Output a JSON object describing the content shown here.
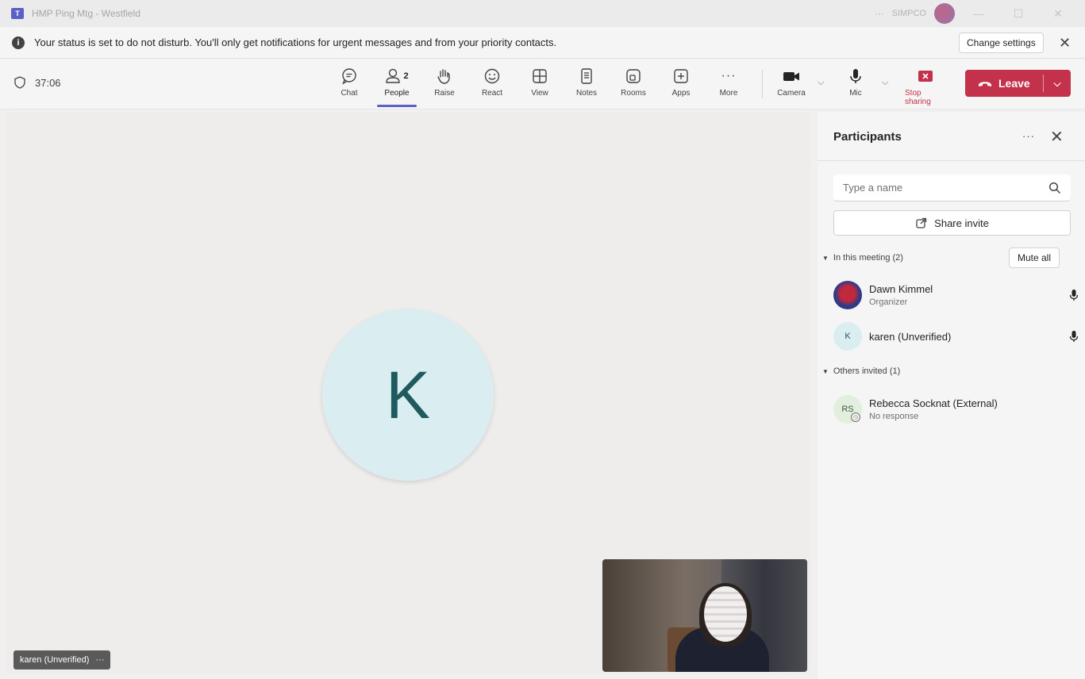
{
  "window": {
    "title": "HMP Ping Mtg - Westfield",
    "more": "···",
    "org": "SIMPCO",
    "app_icon": "teams-logo"
  },
  "notification": {
    "icon": "info-icon",
    "text": "Your status is set to do not disturb. You'll only get notifications for urgent messages and from your priority contacts.",
    "button": "Change settings"
  },
  "toolbar": {
    "timer": "37:06",
    "chat": "Chat",
    "people": "People",
    "people_count": "2",
    "raise": "Raise",
    "react": "React",
    "view": "View",
    "notes": "Notes",
    "rooms": "Rooms",
    "apps": "Apps",
    "more": "More",
    "camera": "Camera",
    "mic": "Mic",
    "stop_sharing": "Stop sharing",
    "leave": "Leave",
    "accent_color": "#5b5fc7",
    "leave_color": "#c4314b"
  },
  "stage": {
    "avatar_initial": "K",
    "name_tag": "karen (Unverified)",
    "name_tag_more": "···"
  },
  "participants": {
    "title": "Participants",
    "more": "···",
    "search_placeholder": "Type a name",
    "share_invite": "Share invite",
    "in_meeting_label": "In this meeting (2)",
    "mute_all": "Mute all",
    "others_label": "Others invited (1)",
    "people": [
      {
        "name": "Dawn Kimmel",
        "role": "Organizer",
        "initials": ""
      },
      {
        "name": "karen (Unverified)",
        "role": "",
        "initials": "K"
      }
    ],
    "invited": [
      {
        "name": "Rebecca Socknat (External)",
        "status": "No response",
        "initials": "RS"
      }
    ]
  }
}
